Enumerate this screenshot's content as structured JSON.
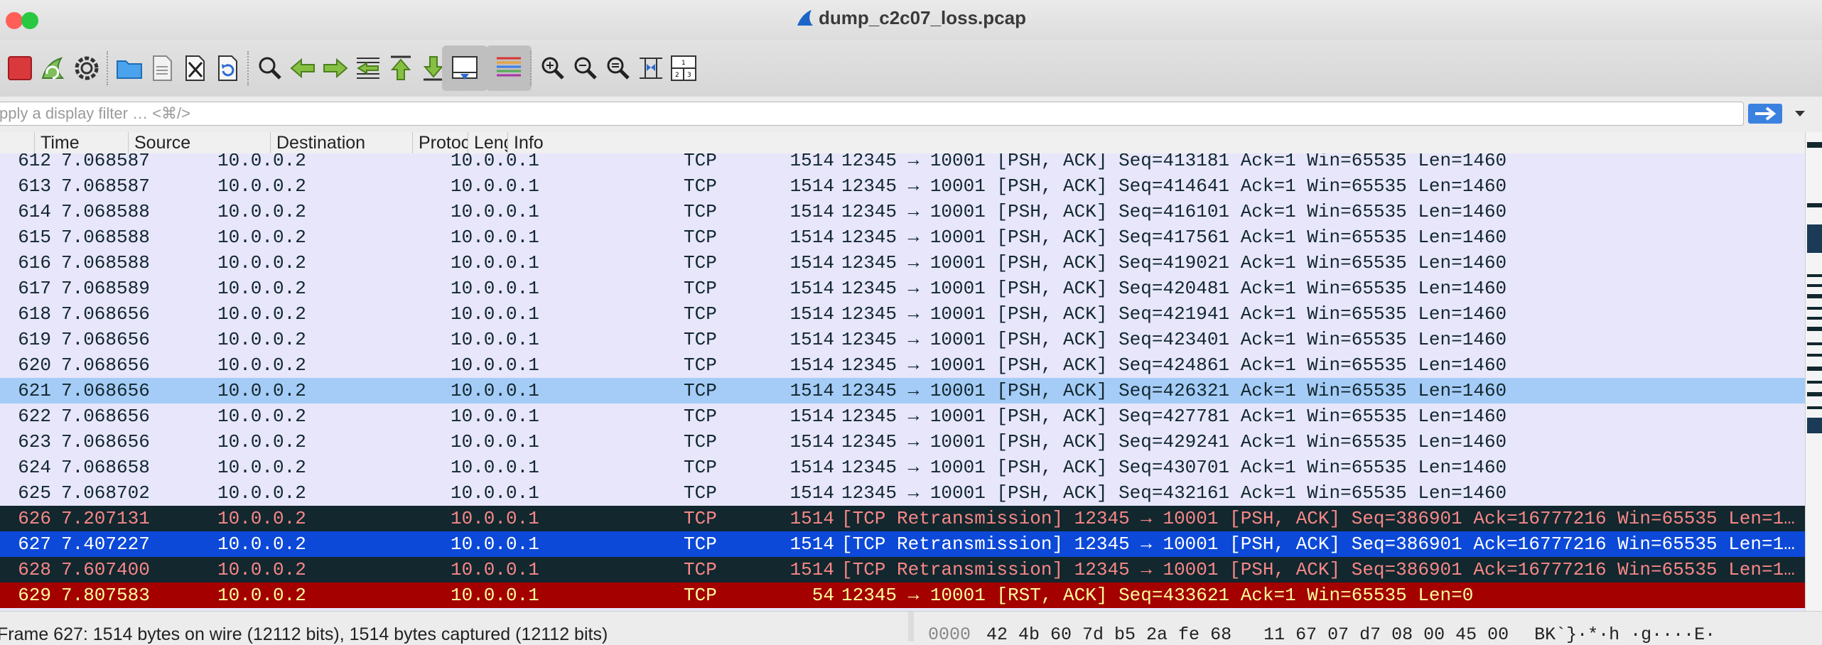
{
  "window": {
    "title": "dump_c2c07_loss.pcap",
    "traffic_colors": [
      "#ff5f57",
      "#febc2e",
      "#28c840"
    ]
  },
  "toolbar": {
    "buttons": [
      {
        "name": "stop-capture",
        "icon": "stop-square-icon",
        "active": false
      },
      {
        "name": "restart-capture",
        "icon": "shark-fin-restart-icon",
        "active": false
      },
      {
        "name": "capture-options",
        "icon": "gear-icon",
        "active": false
      },
      {
        "name": "open-file",
        "icon": "folder-icon",
        "active": false
      },
      {
        "name": "save-file",
        "icon": "document-icon",
        "active": false
      },
      {
        "name": "close-file",
        "icon": "close-file-icon",
        "active": false
      },
      {
        "name": "reload-file",
        "icon": "reload-icon",
        "active": false
      },
      {
        "name": "find-packet",
        "icon": "magnifier-icon",
        "active": false
      },
      {
        "name": "go-back",
        "icon": "arrow-left-icon",
        "active": false
      },
      {
        "name": "go-forward",
        "icon": "arrow-right-icon",
        "active": false
      },
      {
        "name": "go-to-packet",
        "icon": "jump-to-icon",
        "active": false
      },
      {
        "name": "go-first",
        "icon": "arrow-up-icon",
        "active": false
      },
      {
        "name": "go-last",
        "icon": "arrow-down-icon",
        "active": false
      },
      {
        "name": "auto-scroll",
        "icon": "auto-scroll-icon",
        "active": true
      },
      {
        "name": "colorize",
        "icon": "colorize-lines-icon",
        "active": true
      },
      {
        "name": "zoom-in",
        "icon": "zoom-in-icon",
        "active": false
      },
      {
        "name": "zoom-out",
        "icon": "zoom-out-icon",
        "active": false
      },
      {
        "name": "normal-size",
        "icon": "zoom-reset-icon",
        "active": false
      },
      {
        "name": "resize-columns",
        "icon": "resize-columns-icon",
        "active": false
      },
      {
        "name": "layout",
        "icon": "layout-panes-icon",
        "active": false
      }
    ]
  },
  "filter": {
    "placeholder": "pply a display filter … <⌘/>"
  },
  "packet_list": {
    "columns": [
      "",
      "Time",
      "Source",
      "Destination",
      "Protocol",
      "Length",
      "Info"
    ],
    "rows": [
      {
        "no": "612",
        "time": "7.068587",
        "src": "10.0.0.2",
        "dst": "10.0.0.1",
        "proto": "TCP",
        "len": "1514",
        "info": "12345 → 10001 [PSH, ACK] Seq=413181 Ack=1 Win=65535 Len=1460",
        "bg": "#e7e6fb",
        "fg": "#12272e"
      },
      {
        "no": "613",
        "time": "7.068587",
        "src": "10.0.0.2",
        "dst": "10.0.0.1",
        "proto": "TCP",
        "len": "1514",
        "info": "12345 → 10001 [PSH, ACK] Seq=414641 Ack=1 Win=65535 Len=1460",
        "bg": "#e7e6fb",
        "fg": "#12272e"
      },
      {
        "no": "614",
        "time": "7.068588",
        "src": "10.0.0.2",
        "dst": "10.0.0.1",
        "proto": "TCP",
        "len": "1514",
        "info": "12345 → 10001 [PSH, ACK] Seq=416101 Ack=1 Win=65535 Len=1460",
        "bg": "#e7e6fb",
        "fg": "#12272e"
      },
      {
        "no": "615",
        "time": "7.068588",
        "src": "10.0.0.2",
        "dst": "10.0.0.1",
        "proto": "TCP",
        "len": "1514",
        "info": "12345 → 10001 [PSH, ACK] Seq=417561 Ack=1 Win=65535 Len=1460",
        "bg": "#e7e6fb",
        "fg": "#12272e"
      },
      {
        "no": "616",
        "time": "7.068588",
        "src": "10.0.0.2",
        "dst": "10.0.0.1",
        "proto": "TCP",
        "len": "1514",
        "info": "12345 → 10001 [PSH, ACK] Seq=419021 Ack=1 Win=65535 Len=1460",
        "bg": "#e7e6fb",
        "fg": "#12272e"
      },
      {
        "no": "617",
        "time": "7.068589",
        "src": "10.0.0.2",
        "dst": "10.0.0.1",
        "proto": "TCP",
        "len": "1514",
        "info": "12345 → 10001 [PSH, ACK] Seq=420481 Ack=1 Win=65535 Len=1460",
        "bg": "#e7e6fb",
        "fg": "#12272e"
      },
      {
        "no": "618",
        "time": "7.068656",
        "src": "10.0.0.2",
        "dst": "10.0.0.1",
        "proto": "TCP",
        "len": "1514",
        "info": "12345 → 10001 [PSH, ACK] Seq=421941 Ack=1 Win=65535 Len=1460",
        "bg": "#e7e6fb",
        "fg": "#12272e"
      },
      {
        "no": "619",
        "time": "7.068656",
        "src": "10.0.0.2",
        "dst": "10.0.0.1",
        "proto": "TCP",
        "len": "1514",
        "info": "12345 → 10001 [PSH, ACK] Seq=423401 Ack=1 Win=65535 Len=1460",
        "bg": "#e7e6fb",
        "fg": "#12272e"
      },
      {
        "no": "620",
        "time": "7.068656",
        "src": "10.0.0.2",
        "dst": "10.0.0.1",
        "proto": "TCP",
        "len": "1514",
        "info": "12345 → 10001 [PSH, ACK] Seq=424861 Ack=1 Win=65535 Len=1460",
        "bg": "#e7e6fb",
        "fg": "#12272e"
      },
      {
        "no": "621",
        "time": "7.068656",
        "src": "10.0.0.2",
        "dst": "10.0.0.1",
        "proto": "TCP",
        "len": "1514",
        "info": "12345 → 10001 [PSH, ACK] Seq=426321 Ack=1 Win=65535 Len=1460",
        "bg": "#a5ccf6",
        "fg": "#12272e"
      },
      {
        "no": "622",
        "time": "7.068656",
        "src": "10.0.0.2",
        "dst": "10.0.0.1",
        "proto": "TCP",
        "len": "1514",
        "info": "12345 → 10001 [PSH, ACK] Seq=427781 Ack=1 Win=65535 Len=1460",
        "bg": "#e7e6fb",
        "fg": "#12272e"
      },
      {
        "no": "623",
        "time": "7.068656",
        "src": "10.0.0.2",
        "dst": "10.0.0.1",
        "proto": "TCP",
        "len": "1514",
        "info": "12345 → 10001 [PSH, ACK] Seq=429241 Ack=1 Win=65535 Len=1460",
        "bg": "#e7e6fb",
        "fg": "#12272e"
      },
      {
        "no": "624",
        "time": "7.068658",
        "src": "10.0.0.2",
        "dst": "10.0.0.1",
        "proto": "TCP",
        "len": "1514",
        "info": "12345 → 10001 [PSH, ACK] Seq=430701 Ack=1 Win=65535 Len=1460",
        "bg": "#e7e6fb",
        "fg": "#12272e"
      },
      {
        "no": "625",
        "time": "7.068702",
        "src": "10.0.0.2",
        "dst": "10.0.0.1",
        "proto": "TCP",
        "len": "1514",
        "info": "12345 → 10001 [PSH, ACK] Seq=432161 Ack=1 Win=65535 Len=1460",
        "bg": "#e7e6fb",
        "fg": "#12272e"
      },
      {
        "no": "626",
        "time": "7.207131",
        "src": "10.0.0.2",
        "dst": "10.0.0.1",
        "proto": "TCP",
        "len": "1514",
        "info": "[TCP Retransmission] 12345 → 10001 [PSH, ACK] Seq=386901 Ack=16777216 Win=65535 Len=1…",
        "bg": "#12272e",
        "fg": "#f78787"
      },
      {
        "no": "627",
        "time": "7.407227",
        "src": "10.0.0.2",
        "dst": "10.0.0.1",
        "proto": "TCP",
        "len": "1514",
        "info": "[TCP Retransmission] 12345 → 10001 [PSH, ACK] Seq=386901 Ack=16777216 Win=65535 Len=1…",
        "bg": "#0c49d8",
        "fg": "#ffffff"
      },
      {
        "no": "628",
        "time": "7.607400",
        "src": "10.0.0.2",
        "dst": "10.0.0.1",
        "proto": "TCP",
        "len": "1514",
        "info": "[TCP Retransmission] 12345 → 10001 [PSH, ACK] Seq=386901 Ack=16777216 Win=65535 Len=1…",
        "bg": "#12272e",
        "fg": "#f78787"
      },
      {
        "no": "629",
        "time": "7.807583",
        "src": "10.0.0.2",
        "dst": "10.0.0.1",
        "proto": "TCP",
        "len": "54",
        "info": "12345 → 10001 [RST, ACK] Seq=433621 Ack=1 Win=65535 Len=0",
        "bg": "#a40000",
        "fg": "#fffc9c"
      }
    ]
  },
  "status": {
    "frame_text": "Frame 627: 1514 bytes on wire (12112 bits), 1514 bytes captured (12112 bits)",
    "bytes_offset": "0000",
    "bytes_hex": "42 4b 60 7d b5 2a fe 68   11 67 07 d7 08 00 45 00",
    "bytes_ascii": "BK`}·*·h ·g····E·"
  }
}
